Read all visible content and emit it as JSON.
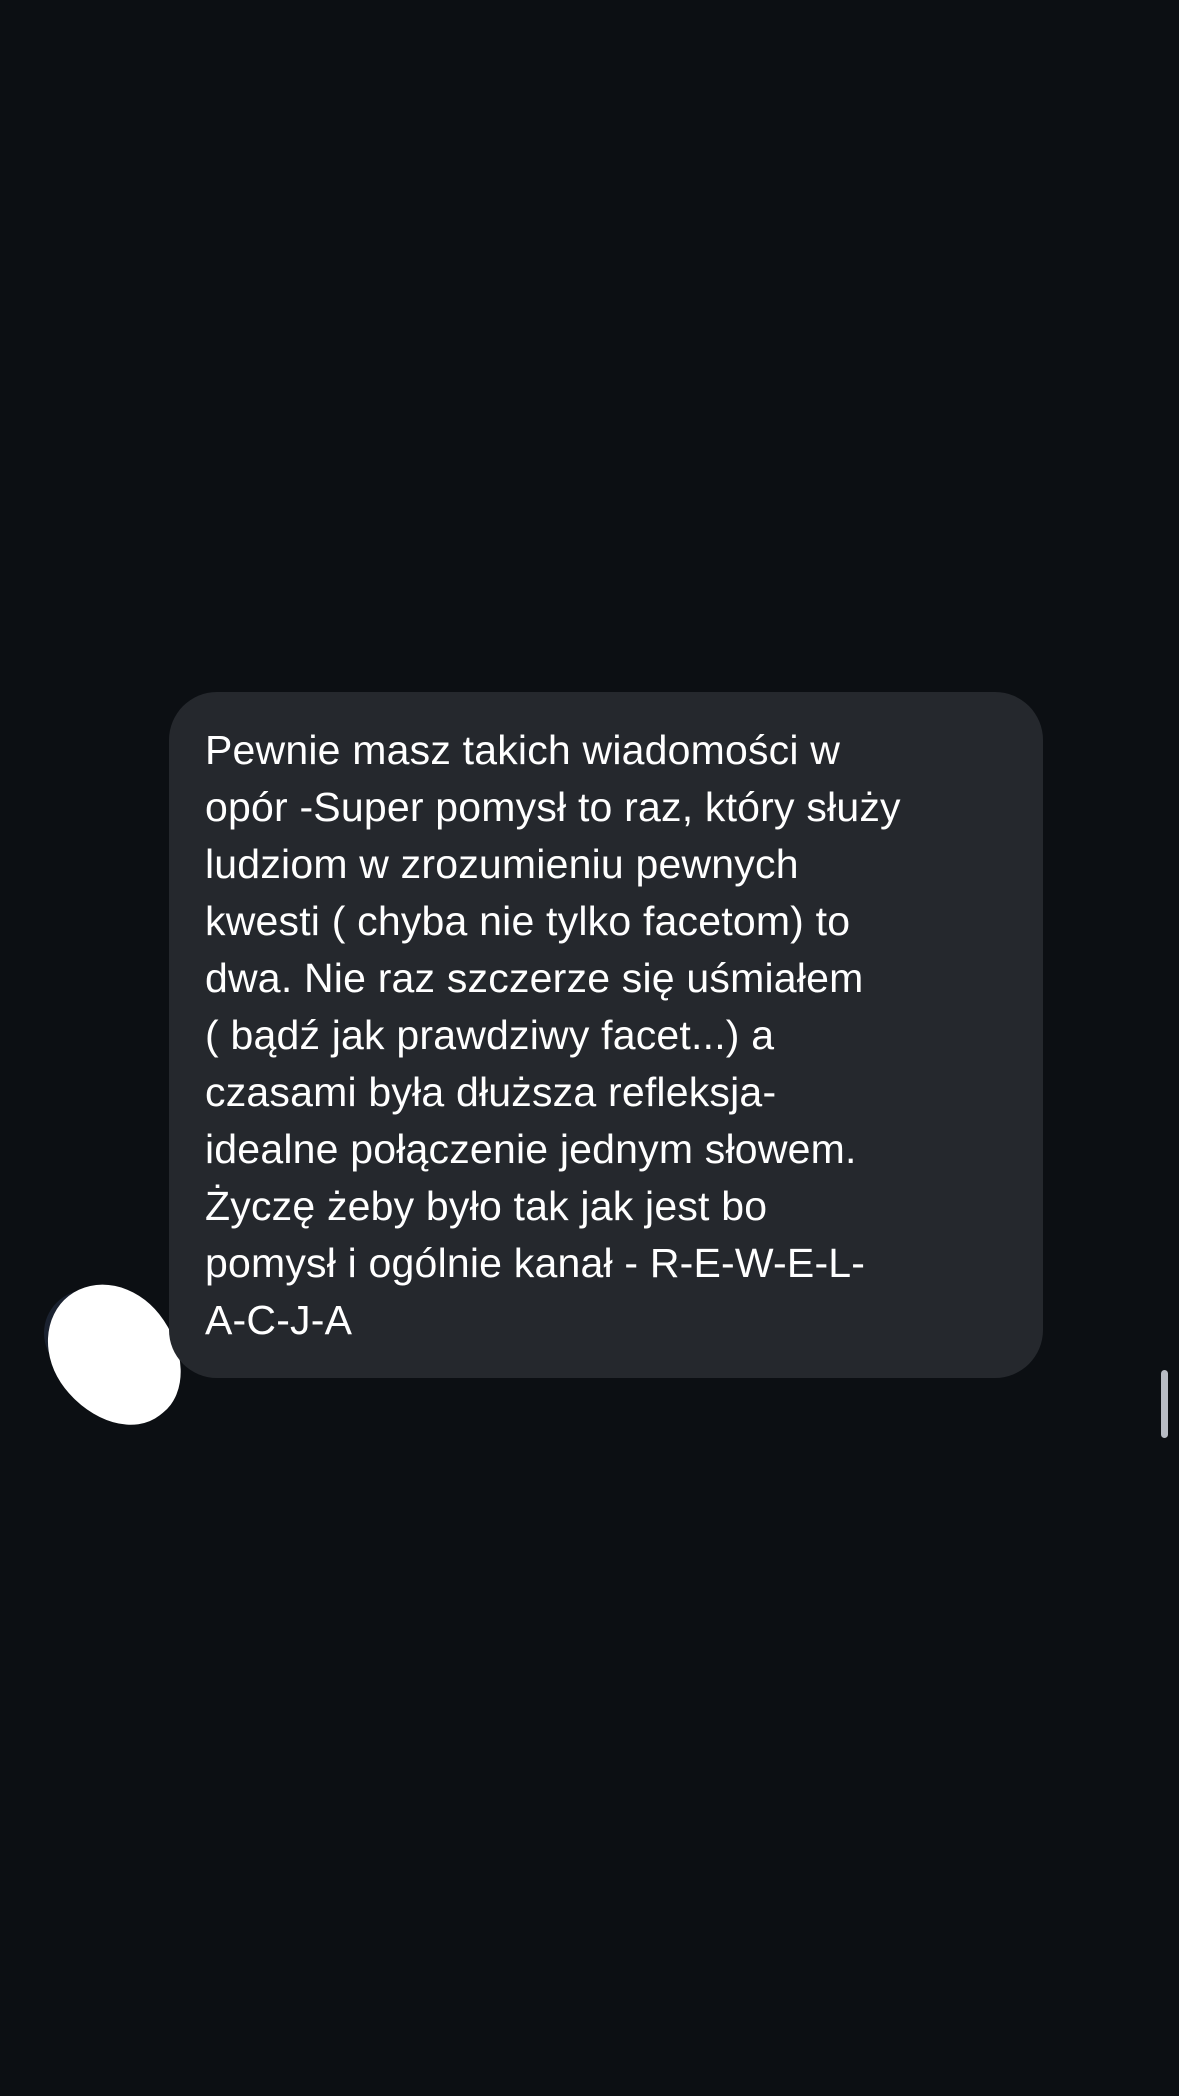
{
  "conversation": {
    "message": {
      "text": "Pewnie masz takich wiadomości w\nopór -Super pomysł to raz, który służy\nludziom w zrozumieniu pewnych\nkwesti ( chyba nie tylko facetom)  to\ndwa.  Nie raz szczerze się uśmiałem\n( bądź jak prawdziwy facet...) a\nczasami była dłuższa refleksja-\nidealne połączenie jednym słowem.\nŻyczę żeby było tak jak jest bo\npomysł i ogólnie kanał - R-E-W-E-L-\nA-C-J-A"
    }
  },
  "colors": {
    "background": "#0c0f13",
    "bubble": "#25282d",
    "text": "#ffffff",
    "scrollbar": "#b8bcc4",
    "avatar_redaction": "#ffffff"
  },
  "icons": {
    "avatar": "sender-avatar",
    "scroll": "scroll-indicator"
  }
}
